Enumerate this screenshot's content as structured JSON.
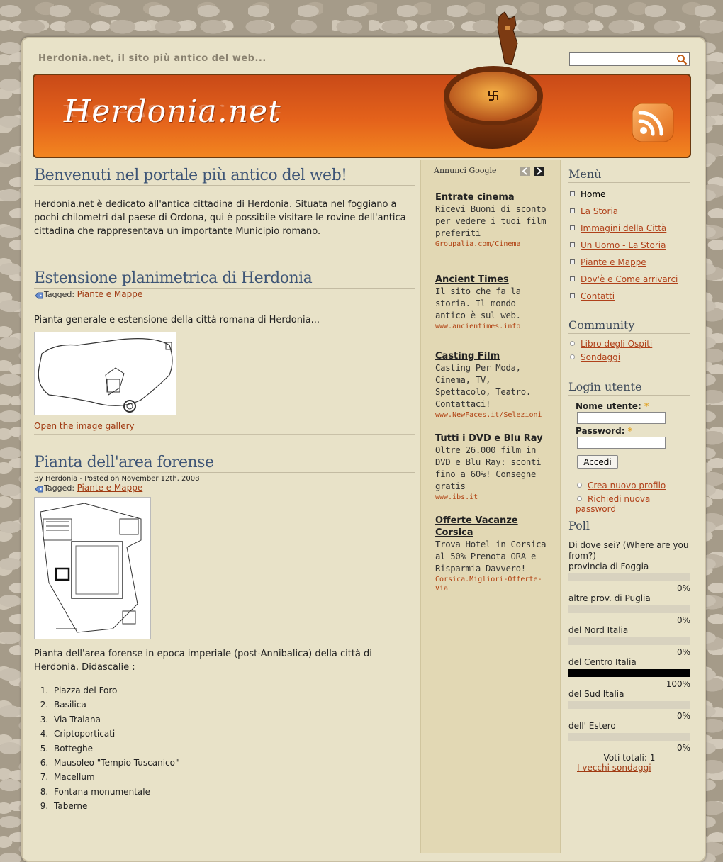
{
  "site": {
    "tagline": "Herdonia.net, il sito più antico del web...",
    "logo": "Herdonia.net",
    "search": {
      "value": "",
      "placeholder": ""
    }
  },
  "main": {
    "welcome": {
      "title": "Benvenuti nel portale più antico del web!",
      "text": "Herdonia.net è dedicato all'antica cittadina di Herdonia. Situata nel foggiano a pochi chilometri dal paese di Ordona, qui è possibile visitare le rovine dell'antica cittadina che rappresentava un importante Municipio romano."
    },
    "post1": {
      "title": "Estensione planimetrica di Herdonia",
      "tagged_label": "Tagged:",
      "tag": "Piante e Mappe",
      "text": "Pianta generale e estensione della città romana di Herdonia...",
      "gallery_link": "Open the image gallery"
    },
    "post2": {
      "title": "Pianta dell'area forense",
      "byline": "By Herdonia - Posted on November 12th, 2008",
      "tagged_label": "Tagged:",
      "tag": "Piante e Mappe",
      "text": "Pianta dell'area forense in epoca imperiale (post-Annibalica) della città di Herdonia. Didascalie :",
      "legend": [
        "Piazza del Foro",
        "Basilica",
        "Via Traiana",
        "Criptoporticati",
        "Botteghe",
        "Mausoleo \"Tempio Tuscanico\"",
        "Macellum",
        "Fontana monumentale",
        "Taberne"
      ]
    }
  },
  "ads": {
    "header": "Annunci Google",
    "items": [
      {
        "title": "Entrate cinema",
        "text": "Ricevi Buoni di sconto per vedere i tuoi film preferiti",
        "url": "Groupalia.com/Cinema"
      },
      {
        "title": "Ancient Times",
        "text": "Il sito che fa la storia. Il mondo antico è sul web.",
        "url": "www.ancientimes.info"
      },
      {
        "title": "Casting Film",
        "text": "Casting Per Moda, Cinema, TV, Spettacolo, Teatro. Contattaci!",
        "url": "www.NewFaces.it/Selezioni"
      },
      {
        "title": "Tutti i DVD e Blu Ray",
        "text": "Oltre 26.000 film in DVD e Blu Ray: sconti fino a 60%! Consegne gratis",
        "url": "www.ibs.it"
      },
      {
        "title": "Offerte Vacanze Corsica",
        "text": "Trova Hotel in Corsica al 50% Prenota ORA e Risparmia Davvero!",
        "url": "Corsica.Migliori-Offerte-Via"
      }
    ]
  },
  "sidebar": {
    "menu": {
      "title": "Menù",
      "items": [
        "Home",
        "La Storia",
        "Immagini della Città",
        "Un Uomo - La Storia",
        "Piante e Mappe",
        "Dov'è e Come arrivarci",
        "Contatti"
      ]
    },
    "community": {
      "title": "Community",
      "items": [
        "Libro degli Ospiti",
        "Sondaggi"
      ]
    },
    "login": {
      "title": "Login utente",
      "username_label": "Nome utente:",
      "password_label": "Password:",
      "required_mark": "*",
      "username_value": "",
      "password_value": "",
      "submit": "Accedi",
      "links": [
        "Crea nuovo profilo",
        "Richiedi nuova password"
      ]
    },
    "poll": {
      "title": "Poll",
      "question": "Di dove sei? (Where are you from?)",
      "options": [
        {
          "label": "provincia di Foggia",
          "percent": 0,
          "percent_text": "0%"
        },
        {
          "label": "altre prov. di Puglia",
          "percent": 0,
          "percent_text": "0%"
        },
        {
          "label": "del Nord Italia",
          "percent": 0,
          "percent_text": "0%"
        },
        {
          "label": "del Centro Italia",
          "percent": 100,
          "percent_text": "100%"
        },
        {
          "label": "del Sud Italia",
          "percent": 0,
          "percent_text": "0%"
        },
        {
          "label": "dell' Estero",
          "percent": 0,
          "percent_text": "0%"
        }
      ],
      "total": "Voti totali: 1",
      "old_polls_link": "I vecchi sondaggi"
    }
  },
  "colors": {
    "accent": "#e4621b",
    "link": "#a03a12",
    "title": "#3e5576"
  }
}
